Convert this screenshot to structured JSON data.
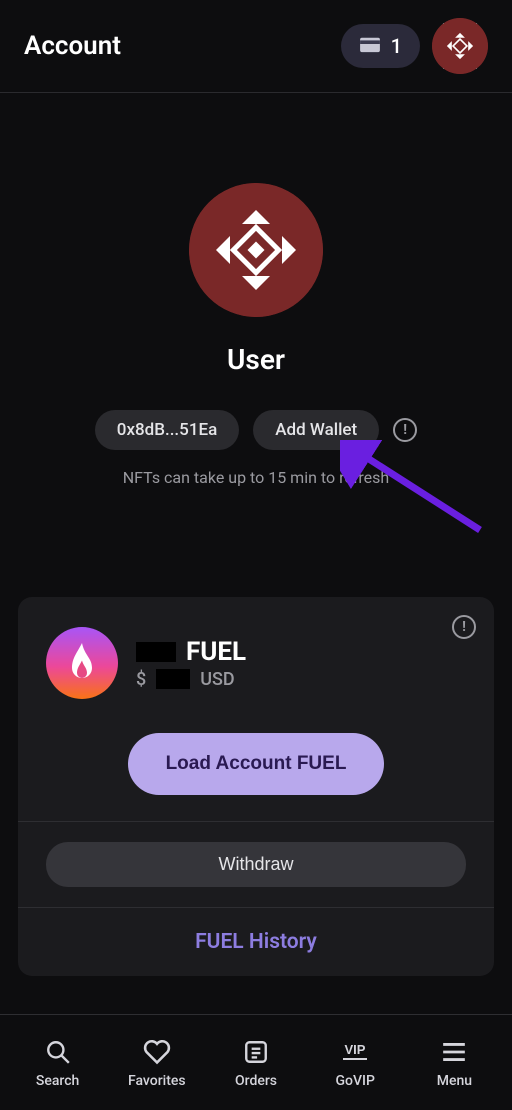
{
  "header": {
    "title": "Account",
    "wallet_count": "1"
  },
  "profile": {
    "username": "User",
    "wallet_short": "0x8dB...51Ea",
    "add_wallet_label": "Add Wallet",
    "refresh_note": "NFTs can take up to 15 min to refresh"
  },
  "fuel": {
    "label": "FUEL",
    "currency_prefix": "$",
    "currency_suffix": "USD",
    "load_label": "Load Account FUEL",
    "withdraw_label": "Withdraw",
    "history_label": "FUEL History"
  },
  "nav": {
    "items": [
      {
        "label": "Search"
      },
      {
        "label": "Favorites"
      },
      {
        "label": "Orders"
      },
      {
        "label": "GoVIP"
      },
      {
        "label": "Menu"
      }
    ]
  }
}
